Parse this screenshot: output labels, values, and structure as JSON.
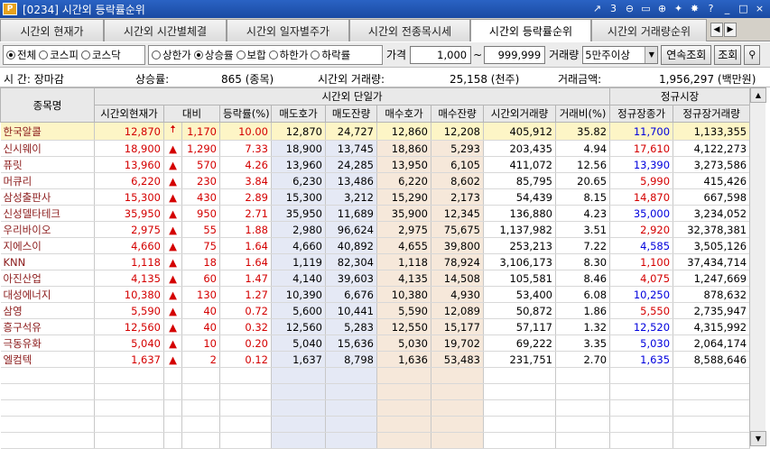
{
  "window": {
    "logo": "P",
    "title": "[0234] 시간외 등락률순위",
    "icons": [
      "link-icon",
      "page-3-icon",
      "zoom-out-icon",
      "copy-icon",
      "zoom-in-icon",
      "pin-icon",
      "settings-icon",
      "help-icon",
      "minimize-icon",
      "maximize-icon",
      "close-icon"
    ],
    "icon_glyphs": [
      "↗",
      "3",
      "⊖",
      "▭",
      "⊕",
      "✦",
      "✸",
      "?",
      "_",
      "□",
      "×"
    ]
  },
  "tabs": [
    {
      "label": "시간외 현재가",
      "active": false
    },
    {
      "label": "시간외 시간별체결",
      "active": false
    },
    {
      "label": "시간외 일자별주가",
      "active": false
    },
    {
      "label": "시간외 전종목시세",
      "active": false
    },
    {
      "label": "시간외 등락률순위",
      "active": true
    },
    {
      "label": "시간외 거래량순위",
      "active": false
    }
  ],
  "tab_arrows": [
    "◀",
    "▶"
  ],
  "filter": {
    "market_options": [
      {
        "label": "전체",
        "on": true
      },
      {
        "label": "코스피",
        "on": false
      },
      {
        "label": "코스닥",
        "on": false
      }
    ],
    "rank_options": [
      {
        "label": "상한가",
        "on": false
      },
      {
        "label": "상승률",
        "on": true
      },
      {
        "label": "보합",
        "on": false
      },
      {
        "label": "하한가",
        "on": false
      },
      {
        "label": "하락률",
        "on": false
      }
    ],
    "price_label": "가격",
    "price_from": "1,000",
    "tilde": "~",
    "price_to": "999,999",
    "volume_label": "거래량",
    "volume_value": "5만주이상",
    "continuous_button": "연속조회",
    "query_button": "조회",
    "filter_icon": "filter-icon"
  },
  "info": {
    "time_label": "시  간: 장마감",
    "rise_label": "상승률:",
    "rise_value": "865 (종목)",
    "volume_label": "시간외 거래량:",
    "volume_value": "25,158 (천주)",
    "amount_label": "거래금액:",
    "amount_value": "1,956,297 (백만원)"
  },
  "table": {
    "header_groups": {
      "name": "종목명",
      "after_hours": "시간외 단일가",
      "regular": "정규시장"
    },
    "columns": [
      "시간외현재가",
      "대비",
      "등락률(%)",
      "매도호가",
      "매도잔량",
      "매수호가",
      "매수잔량",
      "시간외거래량",
      "거래비(%)",
      "정규장종가",
      "정규장거래량"
    ],
    "rows": [
      {
        "name": "한국알콜",
        "price": "12,870",
        "arrow": "up-limit",
        "change": "1,170",
        "rate": "10.00",
        "ask": "12,870",
        "ask_qty": "24,727",
        "bid": "12,860",
        "bid_qty": "12,208",
        "volume": "405,912",
        "vol_ratio": "35.82",
        "close": "11,700",
        "close_color": "blue",
        "reg_volume": "1,133,355"
      },
      {
        "name": "신시웨이",
        "price": "18,900",
        "arrow": "up",
        "change": "1,290",
        "rate": "7.33",
        "ask": "18,900",
        "ask_qty": "13,745",
        "bid": "18,860",
        "bid_qty": "5,293",
        "volume": "203,435",
        "vol_ratio": "4.94",
        "close": "17,610",
        "close_color": "red",
        "reg_volume": "4,122,273"
      },
      {
        "name": "퓨릿",
        "price": "13,960",
        "arrow": "up",
        "change": "570",
        "rate": "4.26",
        "ask": "13,960",
        "ask_qty": "24,285",
        "bid": "13,950",
        "bid_qty": "6,105",
        "volume": "411,072",
        "vol_ratio": "12.56",
        "close": "13,390",
        "close_color": "blue",
        "reg_volume": "3,273,586"
      },
      {
        "name": "머큐리",
        "price": "6,220",
        "arrow": "up",
        "change": "230",
        "rate": "3.84",
        "ask": "6,230",
        "ask_qty": "13,486",
        "bid": "6,220",
        "bid_qty": "8,602",
        "volume": "85,795",
        "vol_ratio": "20.65",
        "close": "5,990",
        "close_color": "red",
        "reg_volume": "415,426"
      },
      {
        "name": "삼성출판사",
        "price": "15,300",
        "arrow": "up",
        "change": "430",
        "rate": "2.89",
        "ask": "15,300",
        "ask_qty": "3,212",
        "bid": "15,290",
        "bid_qty": "2,173",
        "volume": "54,439",
        "vol_ratio": "8.15",
        "close": "14,870",
        "close_color": "red",
        "reg_volume": "667,598"
      },
      {
        "name": "신성델타테크",
        "price": "35,950",
        "arrow": "up",
        "change": "950",
        "rate": "2.71",
        "ask": "35,950",
        "ask_qty": "11,689",
        "bid": "35,900",
        "bid_qty": "12,345",
        "volume": "136,880",
        "vol_ratio": "4.23",
        "close": "35,000",
        "close_color": "blue",
        "reg_volume": "3,234,052"
      },
      {
        "name": "우리바이오",
        "price": "2,975",
        "arrow": "up",
        "change": "55",
        "rate": "1.88",
        "ask": "2,980",
        "ask_qty": "96,624",
        "bid": "2,975",
        "bid_qty": "75,675",
        "volume": "1,137,982",
        "vol_ratio": "3.51",
        "close": "2,920",
        "close_color": "red",
        "reg_volume": "32,378,381"
      },
      {
        "name": "지에스이",
        "price": "4,660",
        "arrow": "up",
        "change": "75",
        "rate": "1.64",
        "ask": "4,660",
        "ask_qty": "40,892",
        "bid": "4,655",
        "bid_qty": "39,800",
        "volume": "253,213",
        "vol_ratio": "7.22",
        "close": "4,585",
        "close_color": "blue",
        "reg_volume": "3,505,126"
      },
      {
        "name": "KNN",
        "price": "1,118",
        "arrow": "up",
        "change": "18",
        "rate": "1.64",
        "ask": "1,119",
        "ask_qty": "82,304",
        "bid": "1,118",
        "bid_qty": "78,924",
        "volume": "3,106,173",
        "vol_ratio": "8.30",
        "close": "1,100",
        "close_color": "red",
        "reg_volume": "37,434,714"
      },
      {
        "name": "아진산업",
        "price": "4,135",
        "arrow": "up",
        "change": "60",
        "rate": "1.47",
        "ask": "4,140",
        "ask_qty": "39,603",
        "bid": "4,135",
        "bid_qty": "14,508",
        "volume": "105,581",
        "vol_ratio": "8.46",
        "close": "4,075",
        "close_color": "red",
        "reg_volume": "1,247,669"
      },
      {
        "name": "대성에너지",
        "price": "10,380",
        "arrow": "up",
        "change": "130",
        "rate": "1.27",
        "ask": "10,390",
        "ask_qty": "6,676",
        "bid": "10,380",
        "bid_qty": "4,930",
        "volume": "53,400",
        "vol_ratio": "6.08",
        "close": "10,250",
        "close_color": "blue",
        "reg_volume": "878,632"
      },
      {
        "name": "삼영",
        "price": "5,590",
        "arrow": "up",
        "change": "40",
        "rate": "0.72",
        "ask": "5,600",
        "ask_qty": "10,441",
        "bid": "5,590",
        "bid_qty": "12,089",
        "volume": "50,872",
        "vol_ratio": "1.86",
        "close": "5,550",
        "close_color": "red",
        "reg_volume": "2,735,947"
      },
      {
        "name": "흥구석유",
        "price": "12,560",
        "arrow": "up",
        "change": "40",
        "rate": "0.32",
        "ask": "12,560",
        "ask_qty": "5,283",
        "bid": "12,550",
        "bid_qty": "15,177",
        "volume": "57,117",
        "vol_ratio": "1.32",
        "close": "12,520",
        "close_color": "blue",
        "reg_volume": "4,315,992"
      },
      {
        "name": "극동유화",
        "price": "5,040",
        "arrow": "up",
        "change": "10",
        "rate": "0.20",
        "ask": "5,040",
        "ask_qty": "15,636",
        "bid": "5,030",
        "bid_qty": "19,702",
        "volume": "69,222",
        "vol_ratio": "3.35",
        "close": "5,030",
        "close_color": "blue",
        "reg_volume": "2,064,174"
      },
      {
        "name": "엘컴텍",
        "price": "1,637",
        "arrow": "up",
        "change": "2",
        "rate": "0.12",
        "ask": "1,637",
        "ask_qty": "8,798",
        "bid": "1,636",
        "bid_qty": "53,483",
        "volume": "231,751",
        "vol_ratio": "2.70",
        "close": "1,635",
        "close_color": "blue",
        "reg_volume": "8,588,646"
      }
    ]
  },
  "arrow_glyphs": {
    "up-limit": "🠅",
    "up": "▲"
  },
  "scrollbar": {
    "up": "▲",
    "down": "▼"
  }
}
